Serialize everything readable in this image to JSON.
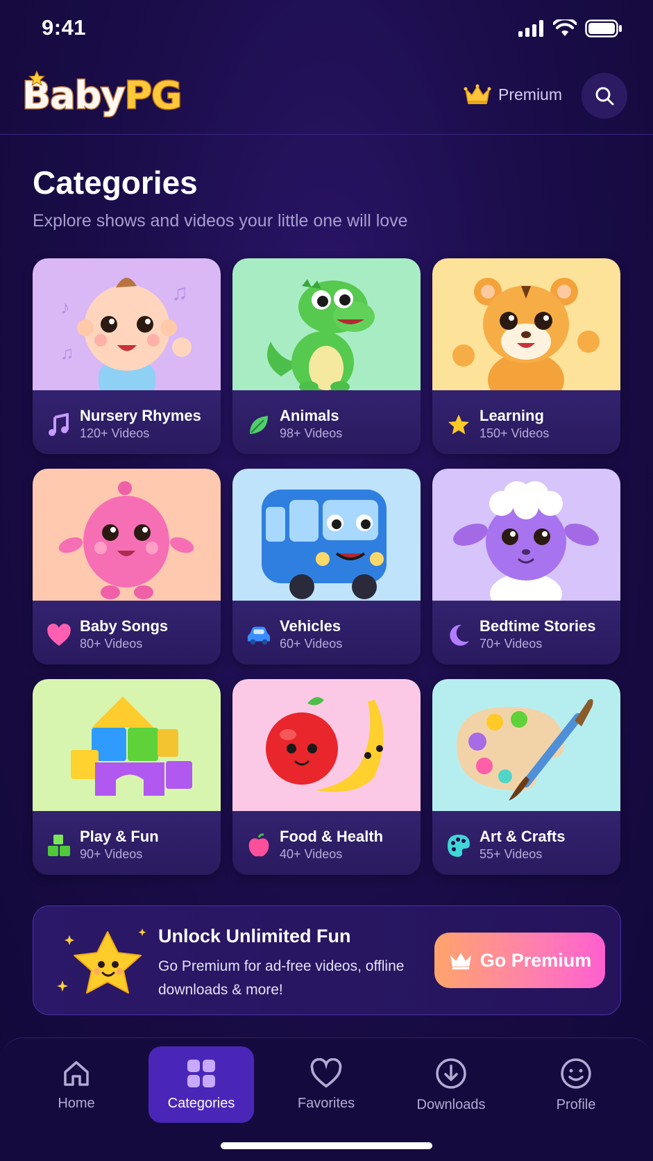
{
  "status_bar": {
    "time": "9:41"
  },
  "header": {
    "logo_part1": "Baby",
    "logo_part2": "PG",
    "premium_label": "Premium"
  },
  "page": {
    "title": "Categories",
    "subtitle": "Explore shows and videos your little one will love"
  },
  "categories": [
    {
      "name": "Nursery Rhymes",
      "count": "120+ Videos",
      "icon": "music-note-icon",
      "bg": "#d9b8f5"
    },
    {
      "name": "Animals",
      "count": "98+ Videos",
      "icon": "leaf-icon",
      "bg": "#a8ecc4"
    },
    {
      "name": "Learning",
      "count": "150+ Videos",
      "icon": "star-icon",
      "bg": "#fde29a"
    },
    {
      "name": "Baby Songs",
      "count": "80+ Videos",
      "icon": "heart-icon",
      "bg": "#ffc9b0"
    },
    {
      "name": "Vehicles",
      "count": "60+ Videos",
      "icon": "car-icon",
      "bg": "#bfe3fb"
    },
    {
      "name": "Bedtime Stories",
      "count": "70+ Videos",
      "icon": "moon-icon",
      "bg": "#d6c4fa"
    },
    {
      "name": "Play & Fun",
      "count": "90+ Videos",
      "icon": "blocks-icon",
      "bg": "#d8f5b0"
    },
    {
      "name": "Food & Health",
      "count": "40+ Videos",
      "icon": "apple-icon",
      "bg": "#fbc9e6"
    },
    {
      "name": "Art & Crafts",
      "count": "55+ Videos",
      "icon": "palette-icon",
      "bg": "#b6eef0"
    }
  ],
  "promo": {
    "title": "Unlock Unlimited Fun",
    "description": "Go Premium for ad-free videos, offline downloads & more!",
    "button_label": "Go Premium"
  },
  "nav": [
    {
      "label": "Home",
      "icon": "home-icon",
      "active": false
    },
    {
      "label": "Categories",
      "icon": "grid-icon",
      "active": true
    },
    {
      "label": "Favorites",
      "icon": "heart-outline-icon",
      "active": false
    },
    {
      "label": "Downloads",
      "icon": "download-icon",
      "active": false
    },
    {
      "label": "Profile",
      "icon": "smile-icon",
      "active": false
    }
  ],
  "colors": {
    "background": "#1b0d4a",
    "accent": "#4a26b8",
    "premium_gold": "#ffc83a",
    "button_gradient_start": "#ffa46b",
    "button_gradient_end": "#ff5fcf"
  }
}
